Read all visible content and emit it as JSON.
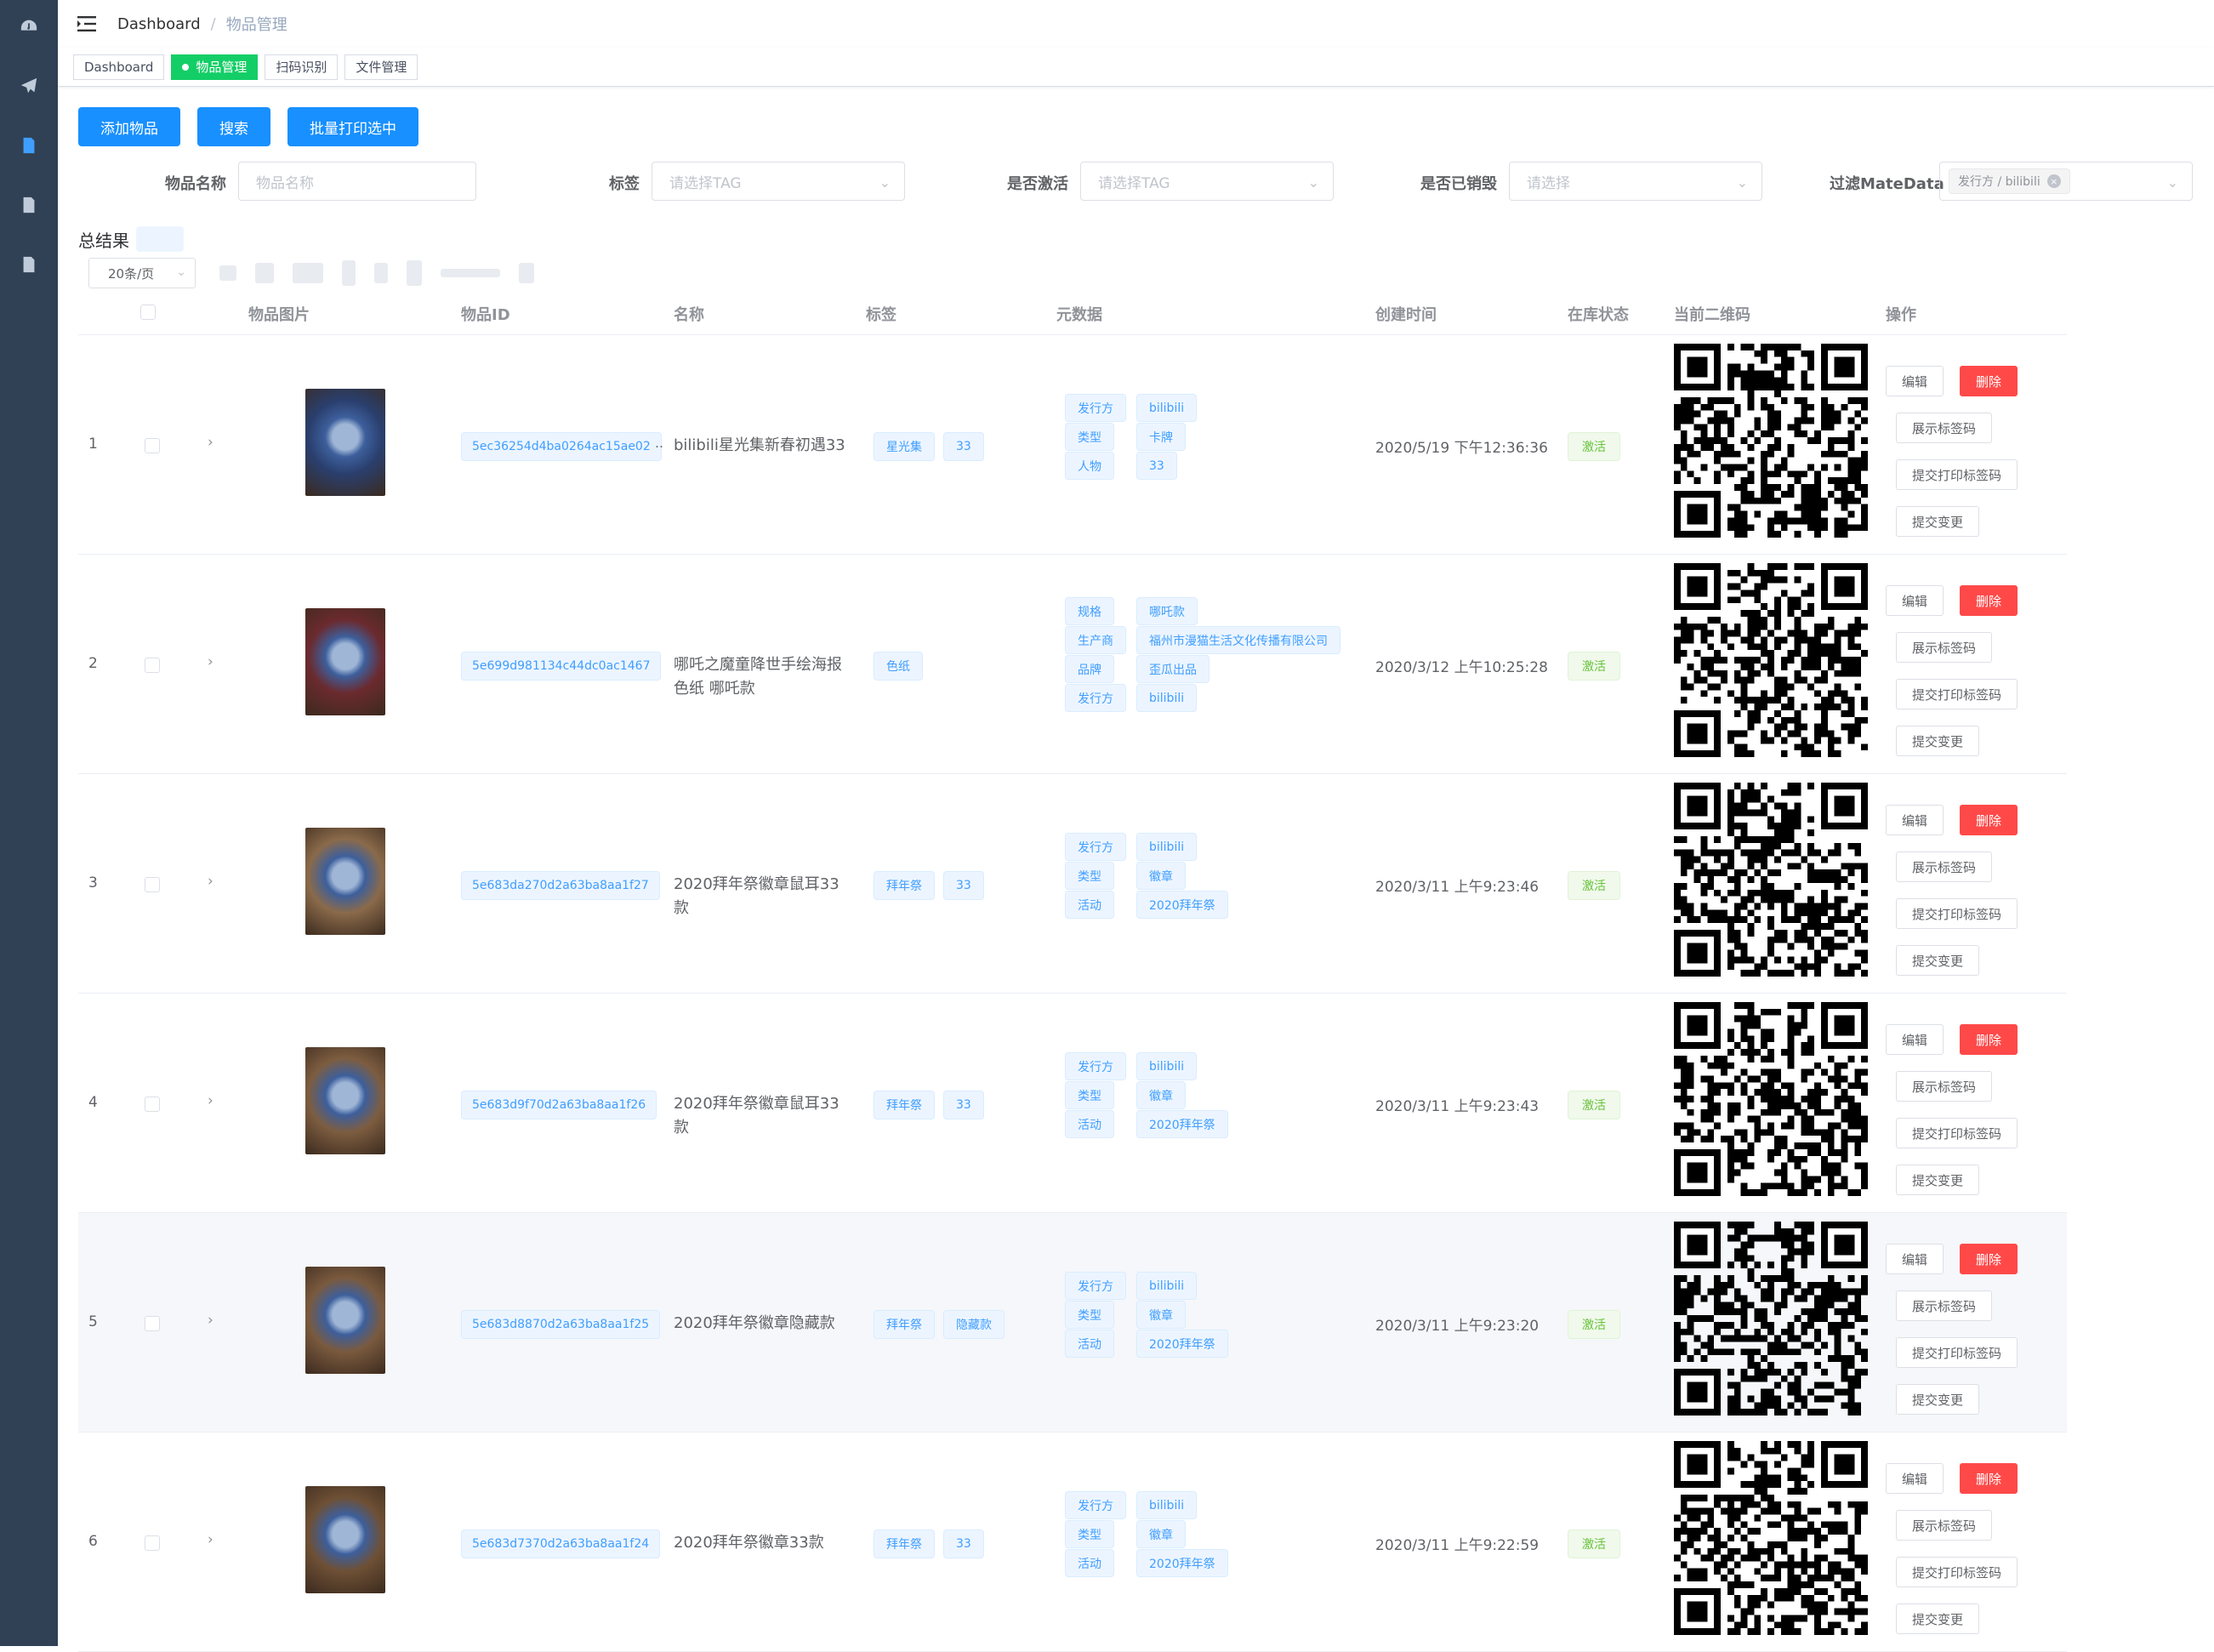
{
  "sidebar": {
    "items": [
      {
        "icon": "dashboard-icon",
        "active": false
      },
      {
        "icon": "paper-plane-icon",
        "active": false
      },
      {
        "icon": "document-icon",
        "active": true
      },
      {
        "icon": "document-icon",
        "active": false
      },
      {
        "icon": "document-icon",
        "active": false
      }
    ]
  },
  "navbar": {
    "breadcrumb": [
      "Dashboard",
      "物品管理"
    ],
    "separator": "/"
  },
  "tagsview": {
    "tabs": [
      {
        "label": "Dashboard",
        "active": false
      },
      {
        "label": "物品管理",
        "active": true
      },
      {
        "label": "扫码识别",
        "active": false
      },
      {
        "label": "文件管理",
        "active": false
      }
    ]
  },
  "toolbar": {
    "add_label": "添加物品",
    "search_label": "搜索",
    "batch_print_label": "批量打印选中"
  },
  "filters": {
    "name_label": "物品名称",
    "name_placeholder": "物品名称",
    "tag_label": "标签",
    "tag_placeholder": "请选择TAG",
    "active_label": "是否激活",
    "active_placeholder": "请选择TAG",
    "destroyed_label": "是否已销毁",
    "destroyed_placeholder": "请选择",
    "metadata_label": "过滤MateData",
    "metadata_chip": "发行方 / bilibili"
  },
  "summary": {
    "total_label": "总结果",
    "page_size": "20条/页"
  },
  "table": {
    "headers": {
      "image": "物品图片",
      "id": "物品ID",
      "name": "名称",
      "tags": "标签",
      "metadata": "元数据",
      "created": "创建时间",
      "status": "在库状态",
      "qrcode": "当前二维码",
      "actions": "操作"
    },
    "actions": {
      "edit": "编辑",
      "delete": "删除",
      "show_label": "展示标签码",
      "submit_print": "提交打印标签码",
      "submit_change": "提交变更"
    },
    "rows": [
      {
        "index": "1",
        "id": "5ec36254d4ba0264ac15ae02",
        "id_truncated": true,
        "name": "bilibili星光集新春初遇33",
        "tags": [
          "星光集",
          "33"
        ],
        "metadata": [
          [
            "发行方",
            "bilibili"
          ],
          [
            "类型",
            "卡牌"
          ],
          [
            "人物",
            "33"
          ]
        ],
        "created": "2020/5/19 下午12:36:36",
        "status": "激活",
        "thumb_color": "#2a3f6e"
      },
      {
        "index": "2",
        "id": "5e699d981134c44dc0ac1467",
        "id_truncated": false,
        "name": "哪吒之魔童降世手绘海报色纸 哪吒款",
        "tags": [
          "色纸"
        ],
        "metadata": [
          [
            "规格",
            "哪吒款"
          ],
          [
            "生产商",
            "福州市漫猫生活文化传播有限公司"
          ],
          [
            "品牌",
            "歪瓜出品"
          ],
          [
            "发行方",
            "bilibili"
          ]
        ],
        "created": "2020/3/12 上午10:25:28",
        "status": "激活",
        "thumb_color": "#6b2a2e"
      },
      {
        "index": "3",
        "id": "5e683da270d2a63ba8aa1f27",
        "id_truncated": false,
        "name": "2020拜年祭徽章鼠耳33款",
        "tags": [
          "拜年祭",
          "33"
        ],
        "metadata": [
          [
            "发行方",
            "bilibili"
          ],
          [
            "类型",
            "徽章"
          ],
          [
            "活动",
            "2020拜年祭"
          ]
        ],
        "created": "2020/3/11 上午9:23:46",
        "status": "激活",
        "thumb_color": "#8a6a4a"
      },
      {
        "index": "4",
        "id": "5e683d9f70d2a63ba8aa1f26",
        "id_truncated": false,
        "name": "2020拜年祭徽章鼠耳33款",
        "tags": [
          "拜年祭",
          "33"
        ],
        "metadata": [
          [
            "发行方",
            "bilibili"
          ],
          [
            "类型",
            "徽章"
          ],
          [
            "活动",
            "2020拜年祭"
          ]
        ],
        "created": "2020/3/11 上午9:23:43",
        "status": "激活",
        "thumb_color": "#7d5d40"
      },
      {
        "index": "5",
        "id": "5e683d8870d2a63ba8aa1f25",
        "id_truncated": false,
        "name": "2020拜年祭徽章隐藏款",
        "tags": [
          "拜年祭",
          "隐藏款"
        ],
        "metadata": [
          [
            "发行方",
            "bilibili"
          ],
          [
            "类型",
            "徽章"
          ],
          [
            "活动",
            "2020拜年祭"
          ]
        ],
        "created": "2020/3/11 上午9:23:20",
        "status": "激活",
        "thumb_color": "#7a5a3e",
        "hover": true
      },
      {
        "index": "6",
        "id": "5e683d7370d2a63ba8aa1f24",
        "id_truncated": false,
        "name": "2020拜年祭徽章33款",
        "tags": [
          "拜年祭",
          "33"
        ],
        "metadata": [
          [
            "发行方",
            "bilibili"
          ],
          [
            "类型",
            "徽章"
          ],
          [
            "活动",
            "2020拜年祭"
          ]
        ],
        "created": "2020/3/11 上午9:22:59",
        "status": "激活",
        "thumb_color": "#6e5035"
      }
    ]
  }
}
